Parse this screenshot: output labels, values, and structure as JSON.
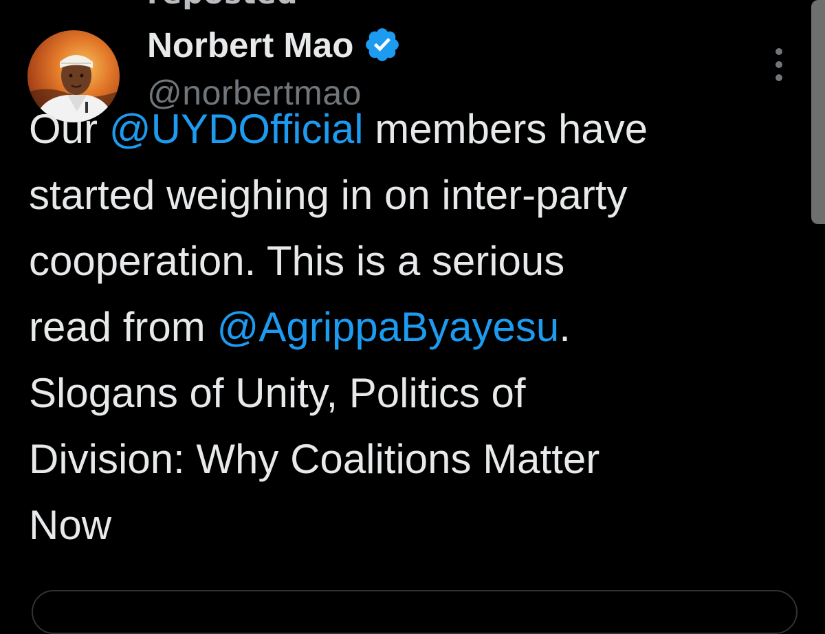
{
  "header": {
    "reposted_label": "reposted"
  },
  "author": {
    "display_name": "Norbert Mao",
    "handle": "@norbertmao",
    "verified": true
  },
  "tweet": {
    "lines": [
      [
        {
          "text": "Our ",
          "mention": false
        },
        {
          "text": "@UYDOfficial",
          "mention": true
        },
        {
          "text": " members have",
          "mention": false
        }
      ],
      [
        {
          "text": "started weighing in on inter-party",
          "mention": false
        }
      ],
      [
        {
          "text": "cooperation. This is a serious",
          "mention": false
        }
      ],
      [
        {
          "text": "read from ",
          "mention": false
        },
        {
          "text": "@AgrippaByayesu",
          "mention": true
        },
        {
          "text": ".",
          "mention": false
        }
      ],
      [
        {
          "text": "Slogans of Unity, Politics of",
          "mention": false
        }
      ],
      [
        {
          "text": "Division: Why Coalitions Matter",
          "mention": false
        }
      ],
      [
        {
          "text": "Now",
          "mention": false
        }
      ]
    ]
  },
  "icons": {
    "verified": "verified-badge-icon",
    "more": "more-options-icon"
  },
  "colors": {
    "background": "#000000",
    "text": "#e7e9ea",
    "secondary_text": "#71767b",
    "mention": "#1d9bf0",
    "verified": "#1d9bf0"
  }
}
